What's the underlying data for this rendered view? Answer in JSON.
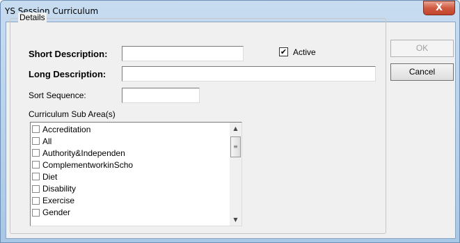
{
  "window": {
    "title": "YS Session Curriculum",
    "close_glyph": "X"
  },
  "details": {
    "group_label": "Details",
    "short_description": {
      "label": "Short Description:",
      "value": ""
    },
    "long_description": {
      "label": "Long Description:",
      "value": ""
    },
    "sort_sequence": {
      "label": "Sort Sequence:",
      "value": ""
    },
    "active": {
      "label": "Active",
      "checked": true,
      "check_glyph": "✔"
    },
    "sub_area_label": "Curriculum Sub Area(s)",
    "sub_areas": [
      "Accreditation",
      "All",
      "Authority&Independen",
      "ComplementworkinScho",
      "Diet",
      "Disability",
      "Exercise",
      "Gender"
    ],
    "scroll_up_glyph": "▲",
    "scroll_down_glyph": "▼",
    "thumb_glyph": "≡"
  },
  "buttons": {
    "ok": "OK",
    "cancel": "Cancel"
  }
}
